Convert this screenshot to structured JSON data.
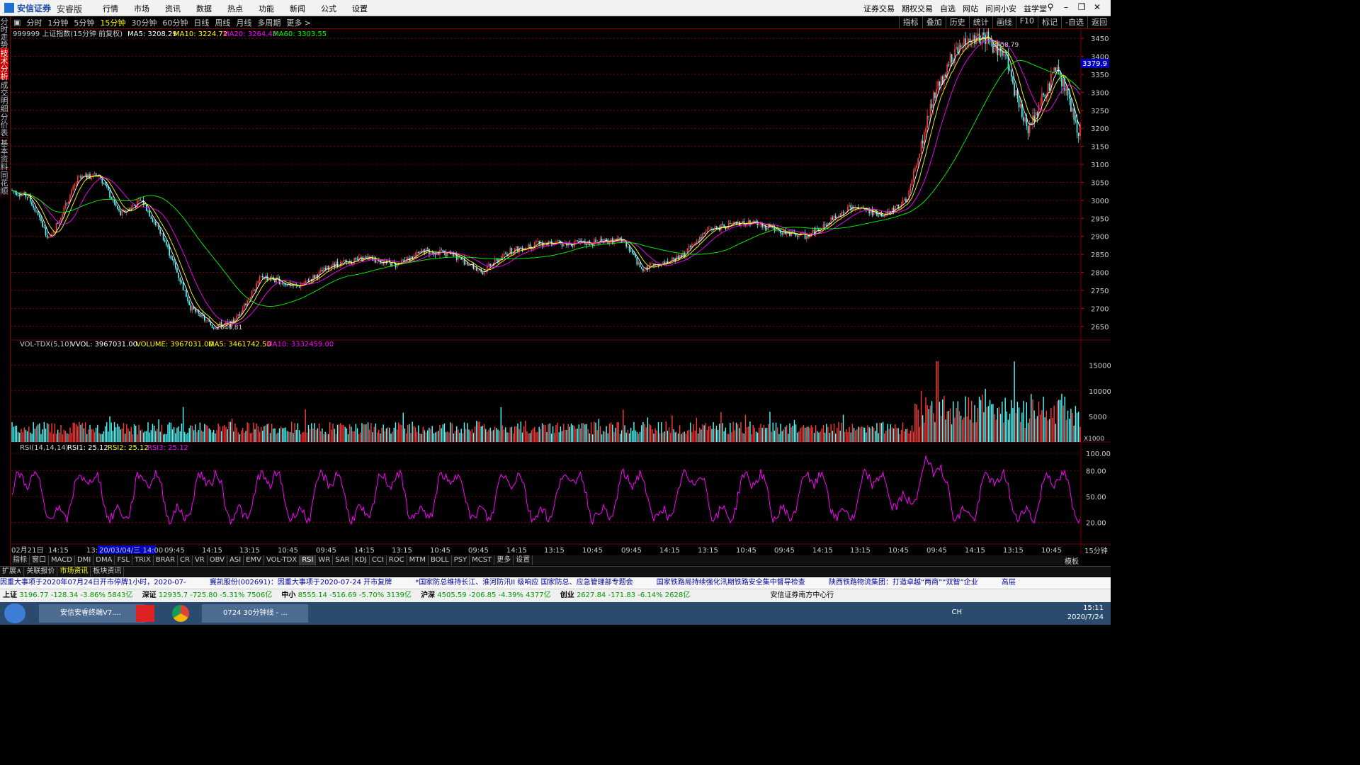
{
  "menubar": {
    "logo": "安信证券",
    "edition": "安睿版",
    "items": [
      "行情",
      "市场",
      "资讯",
      "数据",
      "热点",
      "功能",
      "新闻",
      "公式",
      "设置"
    ],
    "right_items": [
      "证券交易",
      "期权交易",
      "自选",
      "网站",
      "问问小安",
      "益学堂"
    ]
  },
  "leftbar": [
    "分时走势",
    "技术分析",
    "成交明细",
    "分价表",
    "基本资料",
    "同花顺"
  ],
  "periods": [
    "分时",
    "1分钟",
    "5分钟",
    "15分钟",
    "30分钟",
    "60分钟",
    "日线",
    "周线",
    "月线",
    "多周期",
    "更多 >"
  ],
  "selected_period": "15分钟",
  "toolright": [
    "指标",
    "叠加",
    "历史",
    "统计",
    "画线",
    "F10",
    "标记",
    "-自选",
    "返回"
  ],
  "main_header": {
    "title": "999999 上证指数(15分钟 前复权)",
    "ma5": "MA5: 3208.29",
    "ma10": "MA10: 3224.72",
    "ma20": "MA20: 3264.43",
    "ma60": "MA60: 3303.55"
  },
  "price_axis": [
    "3450",
    "3400",
    "3350",
    "3300",
    "3250",
    "3200",
    "3150",
    "3100",
    "3050",
    "3000",
    "2950",
    "2900",
    "2850",
    "2800",
    "2750",
    "2700",
    "2650"
  ],
  "current_price": "3379.9",
  "high_label": "3458.79",
  "low_label": "2646.81",
  "vol_header": {
    "title": "VOL-TDX(5,10)",
    "vvol": "VVOL: 3967031.00",
    "volume": "VOLUME: 3967031.00",
    "ma5": "MA5: 3461742.50",
    "ma10": "MA10: 3332459.00"
  },
  "vol_axis": [
    "15000",
    "10000",
    "5000",
    "X1000"
  ],
  "rsi_header": {
    "title": "RSI(14,14,14)",
    "rsi1": "RSI1: 25.12",
    "rsi2": "RSI2: 25.12",
    "rsi3": "RSI3: 25.12"
  },
  "rsi_axis": [
    "100.00",
    "80.00",
    "50.00",
    "20.00"
  ],
  "time_axis": [
    "02月21日",
    "14:15",
    "13:",
    "20/03/04/三 14:00",
    "09:45",
    "14:15",
    "13:15",
    "10:45",
    "09:45",
    "14:15",
    "13:15",
    "10:45",
    "09:45",
    "14:15",
    "13:15",
    "10:45",
    "09:45",
    "14:15",
    "13:15",
    "10:45",
    "09:45",
    "14:15",
    "13:15",
    "10:45",
    "09:45",
    "14:15",
    "13:15",
    "10:45"
  ],
  "period_label": "15分钟",
  "indicator_tabs": [
    "指标",
    "窗口",
    "MACD",
    "DMI",
    "DMA",
    "FSL",
    "TRIX",
    "BRAR",
    "CR",
    "VR",
    "OBV",
    "ASI",
    "EMV",
    "VOL-TDX",
    "RSI",
    "WR",
    "SAR",
    "KDJ",
    "CCI",
    "ROC",
    "MTM",
    "BOLL",
    "PSY",
    "MCST",
    "更多",
    "设置"
  ],
  "selected_indicator": "RSI",
  "template_label": "模板",
  "ext_tabs": [
    "扩展∧",
    "关联报价",
    "市场资讯",
    "板块资讯"
  ],
  "ticker": [
    "因重大事项于2020年07月24日开市停牌1小时，2020-07-",
    "冀凯股份(002691)：因重大事项于2020-07-24 开市复牌",
    "*国家防总维持长江、淮河防汛II 级响应 国家防总、应急管理部专题会",
    "国家铁路局持续强化汛期铁路安全集中督导检查",
    "陕西铁路物流集团：打造卓越“两商”“双智”企业",
    "高层"
  ],
  "indexbar": [
    {
      "name": "上证",
      "value": "3196.77 -128.34 -3.86% 5843亿"
    },
    {
      "name": "深证",
      "value": "12935.7 -725.80 -5.31% 7506亿"
    },
    {
      "name": "中小",
      "value": "8555.14 -516.69 -5.70% 3139亿"
    },
    {
      "name": "沪深",
      "value": "4505.59 -206.85 -4.39% 4377亿"
    },
    {
      "name": "创业",
      "value": "2627.84 -171.83 -6.14% 2628亿"
    }
  ],
  "broker_node": "安信证券南方中心行",
  "taskbar": {
    "tasks": [
      "安信安睿终端V7....",
      "0724 30分钟线 - ..."
    ],
    "time": "15:11",
    "date": "2020/7/24",
    "ime": "CH"
  },
  "colors": {
    "up": "#ff3b3b",
    "down": "#54ffff",
    "ma5": "#ffffff",
    "ma10": "#ffff00",
    "ma20": "#ff00ff",
    "ma60": "#00ff00",
    "rsi": "#ff00ff",
    "grid": "#800000"
  }
}
